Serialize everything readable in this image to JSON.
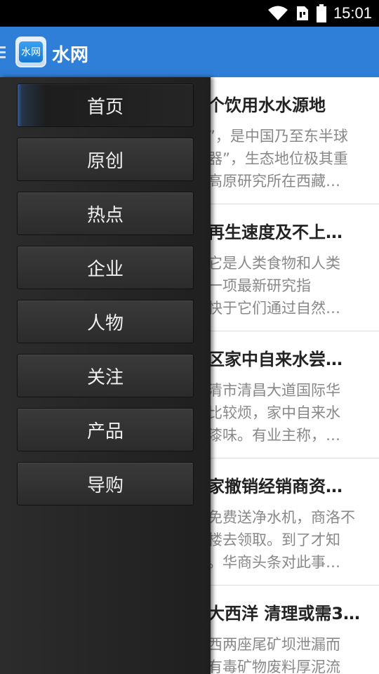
{
  "status_bar": {
    "time": "15:01",
    "icons": [
      "wifi-icon",
      "sim-icon",
      "battery-icon"
    ]
  },
  "action_bar": {
    "logo_text": "水网",
    "title": "水网",
    "accent_color": "#2f7fd8"
  },
  "articles": [
    {
      "title": "个饮用水水源地",
      "summary": [
        "”，是中国乃至东半球",
        "器”，生态地位极其重",
        "高原研究所在西藏…"
      ]
    },
    {
      "title": "再生速度及不上…",
      "summary": [
        "它是人类食物和人类",
        "一项最新研究指",
        "快于它们通过自然…"
      ]
    },
    {
      "title": "区家中自来水尝…",
      "summary": [
        "清市清昌大道国际华",
        "比较烦，家中自来水",
        "漆味。有业主称，…"
      ]
    },
    {
      "title": "家撤销经销商资…",
      "summary": [
        "免费送净水机，商洛不",
        "楼去领取。到了才知",
        "。华商头条对此事…"
      ]
    },
    {
      "title": "大西洋 清理或需3…",
      "summary": [
        "西两座尾矿坝泄漏而",
        "有毒矿物废料厚泥流"
      ]
    }
  ],
  "drawer": {
    "items": [
      {
        "label": "首页",
        "active": true
      },
      {
        "label": "原创"
      },
      {
        "label": "热点"
      },
      {
        "label": "企业"
      },
      {
        "label": "人物"
      },
      {
        "label": "关注"
      },
      {
        "label": "产品"
      },
      {
        "label": "导购"
      }
    ]
  }
}
